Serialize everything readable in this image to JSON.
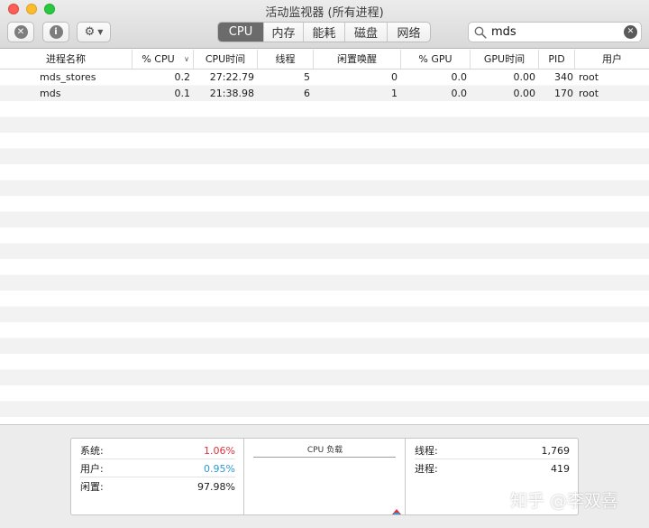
{
  "window": {
    "title": "活动监视器 (所有进程)"
  },
  "toolbar": {
    "stop_icon": "x-circle-icon",
    "info_icon": "info-circle-icon",
    "gear_icon": "gear-icon",
    "tabs": [
      {
        "label": "CPU",
        "active": true
      },
      {
        "label": "内存",
        "active": false
      },
      {
        "label": "能耗",
        "active": false
      },
      {
        "label": "磁盘",
        "active": false
      },
      {
        "label": "网络",
        "active": false
      }
    ],
    "search": {
      "value": "mds",
      "icon": "search-icon",
      "clear_icon": "clear-icon"
    }
  },
  "table": {
    "columns": {
      "name": "进程名称",
      "cpu": "% CPU",
      "cpu_time": "CPU时间",
      "threads": "线程",
      "idle_wake": "闲置唤醒",
      "gpu": "% GPU",
      "gpu_time": "GPU时间",
      "pid": "PID",
      "user": "用户"
    },
    "sort": {
      "column": "% CPU",
      "direction": "descending"
    },
    "rows": [
      {
        "name": "mds_stores",
        "cpu": "0.2",
        "cpu_time": "27:22.79",
        "threads": "5",
        "idle_wake": "0",
        "gpu": "0.0",
        "gpu_time": "0.00",
        "pid": "340",
        "user": "root"
      },
      {
        "name": "mds",
        "cpu": "0.1",
        "cpu_time": "21:38.98",
        "threads": "6",
        "idle_wake": "1",
        "gpu": "0.0",
        "gpu_time": "0.00",
        "pid": "170",
        "user": "root"
      }
    ]
  },
  "summary": {
    "system_label": "系统:",
    "system_value": "1.06%",
    "user_label": "用户:",
    "user_value": "0.95%",
    "idle_label": "闲置:",
    "idle_value": "97.98%",
    "load_title": "CPU 负载",
    "threads_label": "线程:",
    "threads_value": "1,769",
    "processes_label": "进程:",
    "processes_value": "419"
  },
  "colors": {
    "system": "#e0303a",
    "user": "#2a9ad8",
    "active_tab": "#6b6b6b"
  },
  "watermark": "知乎 @李双喜"
}
